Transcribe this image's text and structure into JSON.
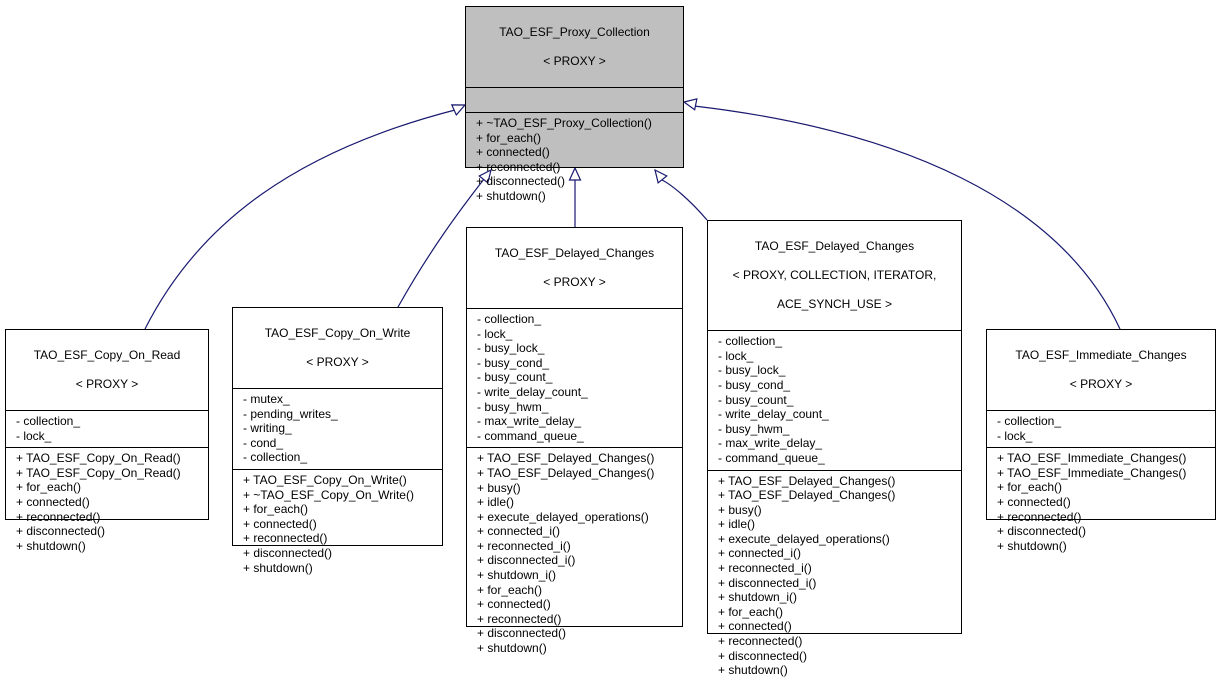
{
  "diagram": {
    "type": "class-inheritance",
    "edge_color": "#191970",
    "base_fill": "#bfbfbf",
    "classes": [
      {
        "id": "proxy_collection",
        "title": [
          "TAO_ESF_Proxy_Collection",
          "< PROXY >"
        ],
        "attributes": [],
        "methods": [
          "+ ~TAO_ESF_Proxy_Collection()",
          "+ for_each()",
          "+ connected()",
          "+ reconnected()",
          "+ disconnected()",
          "+ shutdown()"
        ]
      },
      {
        "id": "copy_on_read",
        "title": [
          "TAO_ESF_Copy_On_Read",
          "< PROXY >"
        ],
        "attributes": [
          "- collection_",
          "- lock_"
        ],
        "methods": [
          "+ TAO_ESF_Copy_On_Read()",
          "+ TAO_ESF_Copy_On_Read()",
          "+ for_each()",
          "+ connected()",
          "+ reconnected()",
          "+ disconnected()",
          "+ shutdown()"
        ]
      },
      {
        "id": "copy_on_write",
        "title": [
          "TAO_ESF_Copy_On_Write",
          "< PROXY >"
        ],
        "attributes": [
          "- mutex_",
          "- pending_writes_",
          "- writing_",
          "- cond_",
          "- collection_"
        ],
        "methods": [
          "+ TAO_ESF_Copy_On_Write()",
          "+ ~TAO_ESF_Copy_On_Write()",
          "+ for_each()",
          "+ connected()",
          "+ reconnected()",
          "+ disconnected()",
          "+ shutdown()"
        ]
      },
      {
        "id": "delayed_changes_proxy",
        "title": [
          "TAO_ESF_Delayed_Changes",
          "< PROXY >"
        ],
        "attributes": [
          "- collection_",
          "- lock_",
          "- busy_lock_",
          "- busy_cond_",
          "- busy_count_",
          "- write_delay_count_",
          "- busy_hwm_",
          "- max_write_delay_",
          "- command_queue_"
        ],
        "methods": [
          "+ TAO_ESF_Delayed_Changes()",
          "+ TAO_ESF_Delayed_Changes()",
          "+ busy()",
          "+ idle()",
          "+ execute_delayed_operations()",
          "+ connected_i()",
          "+ reconnected_i()",
          "+ disconnected_i()",
          "+ shutdown_i()",
          "+ for_each()",
          "+ connected()",
          "+ reconnected()",
          "+ disconnected()",
          "+ shutdown()"
        ]
      },
      {
        "id": "delayed_changes_full",
        "title": [
          "TAO_ESF_Delayed_Changes",
          "< PROXY, COLLECTION, ITERATOR,",
          "ACE_SYNCH_USE >"
        ],
        "attributes": [
          "- collection_",
          "- lock_",
          "- busy_lock_",
          "- busy_cond_",
          "- busy_count_",
          "- write_delay_count_",
          "- busy_hwm_",
          "- max_write_delay_",
          "- command_queue_"
        ],
        "methods": [
          "+ TAO_ESF_Delayed_Changes()",
          "+ TAO_ESF_Delayed_Changes()",
          "+ busy()",
          "+ idle()",
          "+ execute_delayed_operations()",
          "+ connected_i()",
          "+ reconnected_i()",
          "+ disconnected_i()",
          "+ shutdown_i()",
          "+ for_each()",
          "+ connected()",
          "+ reconnected()",
          "+ disconnected()",
          "+ shutdown()"
        ]
      },
      {
        "id": "immediate_changes",
        "title": [
          "TAO_ESF_Immediate_Changes",
          "< PROXY >"
        ],
        "attributes": [
          "- collection_",
          "- lock_"
        ],
        "methods": [
          "+ TAO_ESF_Immediate_Changes()",
          "+ TAO_ESF_Immediate_Changes()",
          "+ for_each()",
          "+ connected()",
          "+ reconnected()",
          "+ disconnected()",
          "+ shutdown()"
        ]
      }
    ],
    "edges": [
      {
        "from": "copy_on_read",
        "to": "proxy_collection"
      },
      {
        "from": "copy_on_write",
        "to": "proxy_collection"
      },
      {
        "from": "delayed_changes_proxy",
        "to": "proxy_collection"
      },
      {
        "from": "delayed_changes_full",
        "to": "proxy_collection"
      },
      {
        "from": "immediate_changes",
        "to": "proxy_collection"
      }
    ]
  }
}
